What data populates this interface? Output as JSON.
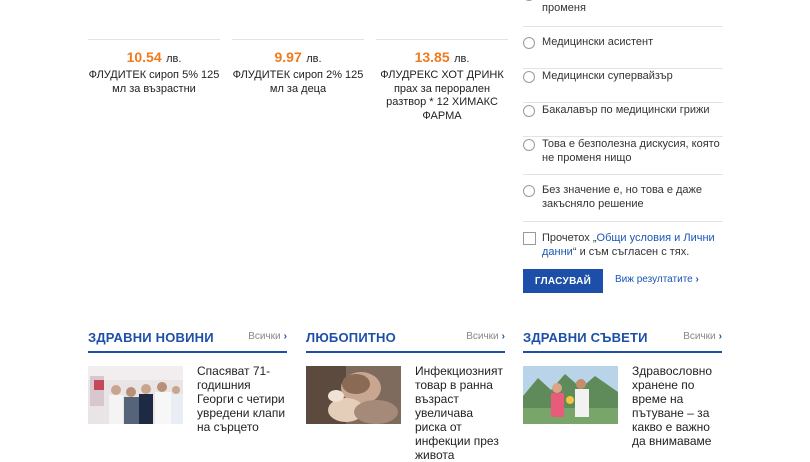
{
  "products": [
    {
      "price": "10.54",
      "currency": "лв.",
      "name": "ФЛУДИТЕК сироп 5% 125 мл за възрастни"
    },
    {
      "price": "9.97",
      "currency": "лв.",
      "name": "ФЛУДИТЕК сироп 2% 125 мл за деца"
    },
    {
      "price": "13.85",
      "currency": "лв.",
      "name": "ФЛУДРЕКС ХОТ ДРИНК прах за перорален разтвор * 12 ХИМАКС ФАРМА"
    }
  ],
  "poll": {
    "partial_option": "променя",
    "options": [
      "Медицински асистент",
      "Медицински супервайзър",
      "Бакалавър по медицински грижи",
      "Това е безполезна дискусия, която не променя нищо",
      "Без значение е, но това е даже закъсняло решение"
    ],
    "consent_prefix": "Прочетох „",
    "consent_link": "Общи условия и Лични данни",
    "consent_suffix": "“ и съм съгласен с тях.",
    "vote_label": "ГЛАСУВАЙ",
    "results_label": "Виж резултатите"
  },
  "sections": [
    {
      "title": "ЗДРАВНИ НОВИНИ",
      "all_label": "Всички",
      "article": "Спасяват 71-годишния Георги с четири увредени клапи на сърцето"
    },
    {
      "title": "ЛЮБОПИТНО",
      "all_label": "Всички",
      "article": "Инфекциозният товар в ранна възраст увеличава риска от инфекции през живота"
    },
    {
      "title": "ЗДРАВНИ СЪВЕТИ",
      "all_label": "Всички",
      "article": "Здравословно хранене по време на пътуване – за какво е важно да внимаваме"
    }
  ],
  "colors": {
    "accent": "#1d4fa8",
    "price": "#f07a1d"
  }
}
